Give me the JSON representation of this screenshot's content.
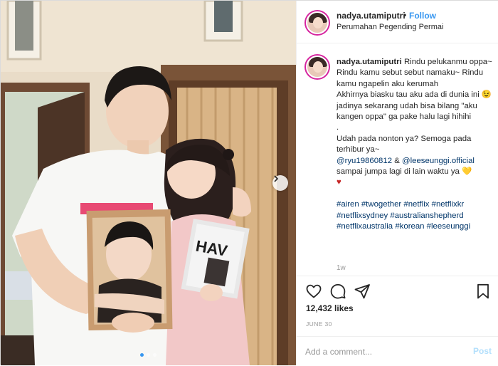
{
  "post": {
    "username": "nadya.utamiputri",
    "separator": "•",
    "follow_label": "Follow",
    "location": "Perumahan Pegending Permai"
  },
  "caption": {
    "username": "nadya.utamiputri",
    "line1": "Rindu pelukanmu oppa~ Rindu kamu sebut sebut namaku~ Rindu kamu ngapelin aku kerumah",
    "line2_a": "Akhirnya biasku tau aku ada di dunia ini",
    "line2_emoji": "😉",
    "line2_b": "jadinya sekarang udah bisa bilang \"aku kangen oppa\" ga pake halu lagi hihihi",
    "dot": ".",
    "line3": "Udah pada nonton ya? Semoga pada terhibur ya~",
    "mention1": "@ryu19860812",
    "amp": "&",
    "mention2": "@leeseunggi.official",
    "line4": "sampai jumpa lagi di lain waktu ya",
    "emoji_heart_yellow": "💛",
    "emoji_heart_red": "♥",
    "hashtags": [
      "#airen",
      "#twogether",
      "#netflix",
      "#netflixkr",
      "#netflixsydney",
      "#australianshepherd",
      "#netflixaustralia",
      "#korean",
      "#leeseunggi"
    ],
    "time_ago": "1w"
  },
  "engagement": {
    "likes": "12,432 likes",
    "date": "JUNE 30"
  },
  "comment": {
    "placeholder": "Add a comment...",
    "post_label": "Post"
  },
  "carousel": {
    "dots": 3,
    "active_dot": 1
  },
  "icons": {
    "like": "heart-outline-icon",
    "comment": "speech-bubble-icon",
    "share": "paper-plane-icon",
    "save": "bookmark-icon",
    "next": "chevron-right-icon"
  },
  "colors": {
    "accent": "#3897f0",
    "hashtag": "#003569",
    "muted": "#999999",
    "post_disabled": "#b2dffc"
  }
}
